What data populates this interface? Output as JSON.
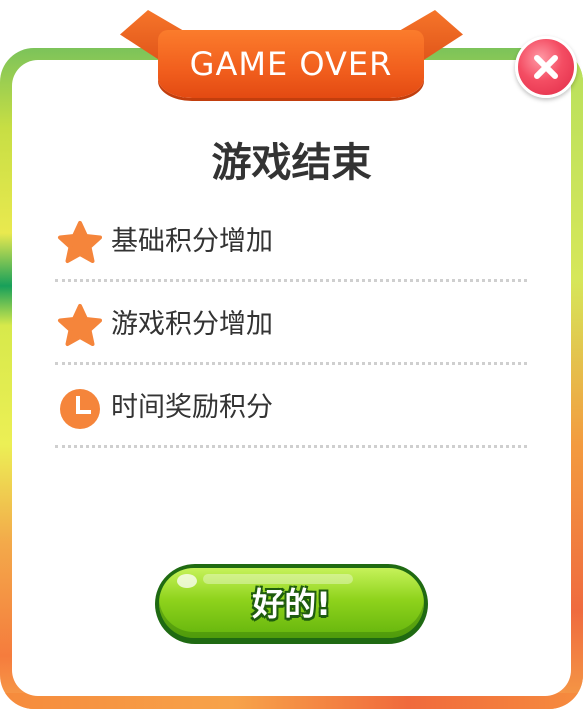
{
  "ribbon": {
    "text": "GAME OVER"
  },
  "dialog": {
    "title": "游戏结束"
  },
  "rows": [
    {
      "icon": "star-icon",
      "label": "基础积分增加"
    },
    {
      "icon": "star-icon",
      "label": "游戏积分增加"
    },
    {
      "icon": "clock-icon",
      "label": "时间奖励积分"
    }
  ],
  "ok_button": {
    "label": "好的!"
  },
  "close_button": {
    "icon": "close-icon"
  },
  "colors": {
    "accent_orange": "#f5853b",
    "button_green": "#8fd31c",
    "close_red": "#f44d63",
    "text_dark": "#333333"
  }
}
